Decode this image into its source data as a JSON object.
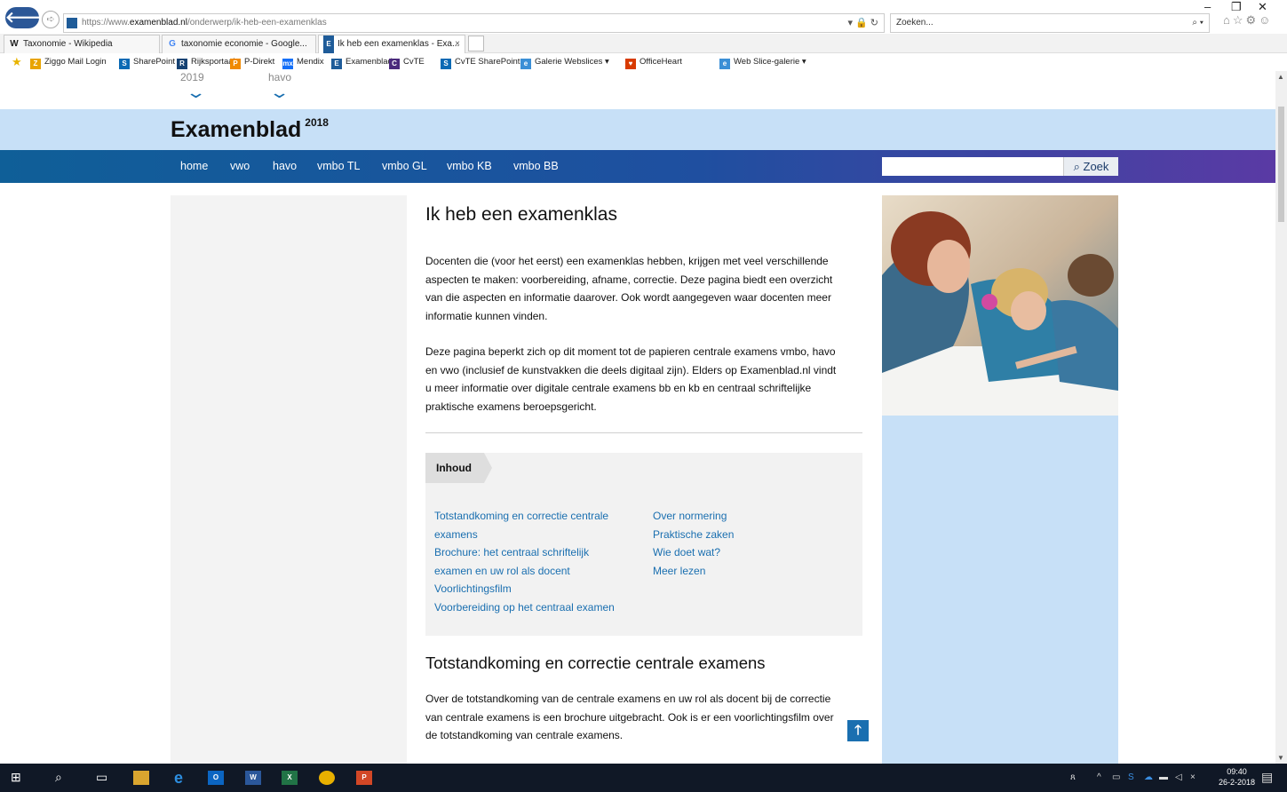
{
  "browser": {
    "url_prefix": "https://www.",
    "url_domain": "examenblad.nl",
    "url_path": "/onderwerp/ik-heb-een-examenklas",
    "search_placeholder": "Zoeken...",
    "tabs": [
      {
        "label": "Taxonomie - Wikipedia",
        "icon": "W"
      },
      {
        "label": "taxonomie economie - Google...",
        "icon": "G"
      },
      {
        "label": "Ik heb een examenklas - Exa...",
        "icon": "E",
        "close": "×"
      }
    ],
    "favorites": [
      {
        "label": "Ziggo Mail Login",
        "color": "#e8a400",
        "icon": "Z"
      },
      {
        "label": "SharePoint",
        "color": "#0b6ab4",
        "icon": "S"
      },
      {
        "label": "Rijksportaal",
        "color": "#154273",
        "icon": "R"
      },
      {
        "label": "P-Direkt",
        "color": "#f08a00",
        "icon": "P"
      },
      {
        "label": "Mendix",
        "color": "#146ff8",
        "icon": "mx"
      },
      {
        "label": "Examenblad",
        "color": "#1f5c99",
        "icon": "E"
      },
      {
        "label": "CvTE",
        "color": "#4b2a7d",
        "icon": "C"
      },
      {
        "label": "CvTE SharePoint",
        "color": "#0b6ab4",
        "icon": "S"
      },
      {
        "label": "Galerie Webslices ▾",
        "color": "#3b8fd6",
        "icon": "e"
      },
      {
        "label": "OfficeHeart",
        "color": "#d83b01",
        "icon": "♥"
      },
      {
        "label": "Web Slice-galerie ▾",
        "color": "#3b8fd6",
        "icon": "e"
      }
    ]
  },
  "page": {
    "crumbs": [
      {
        "label": "2019"
      },
      {
        "label": "havo"
      }
    ],
    "site_title": "Examenblad",
    "site_year": "2018",
    "nav": [
      "home",
      "vwo",
      "havo",
      "vmbo TL",
      "vmbo GL",
      "vmbo KB",
      "vmbo BB"
    ],
    "search_button": "Zoek",
    "heading": "Ik heb een examenklas",
    "intro_lines_1": [
      "Docenten die (voor het eerst) een examenklas hebben, krijgen met veel verschillende",
      "aspecten te maken: voorbereiding, afname, correctie. Deze pagina biedt een overzicht",
      "van die aspecten en informatie daarover. Ook wordt aangegeven waar docenten meer",
      "informatie kunnen vinden."
    ],
    "intro_lines_2": [
      "Deze pagina beperkt zich op dit moment tot de papieren centrale examens vmbo, havo",
      "en vwo (inclusief de kunstvakken die deels digitaal zijn). Elders op Examenblad.nl vindt",
      "u meer informatie over digitale centrale examens bb en kb en centraal schriftelijke",
      "praktische examens beroepsgericht."
    ],
    "toc_title": "Inhoud",
    "toc_left": [
      "Totstandkoming en correctie centrale",
      "examens",
      "Brochure: het centraal schriftelijk",
      "examen en uw rol als docent",
      "Voorlichtingsfilm",
      "Voorbereiding op het centraal examen"
    ],
    "toc_right": [
      "Over normering",
      "Praktische zaken",
      "Wie doet wat?",
      "Meer lezen"
    ],
    "section_heading": "Totstandkoming en correctie centrale examens",
    "section_lines": [
      "Over de totstandkoming van de centrale examens en uw rol als docent bij de correctie",
      "van centrale examens is een brochure uitgebracht. Ook is er een voorlichtingsfilm over",
      "de totstandkoming van centrale examens."
    ]
  },
  "taskbar": {
    "time": "09:40",
    "date": "26-2-2018"
  }
}
